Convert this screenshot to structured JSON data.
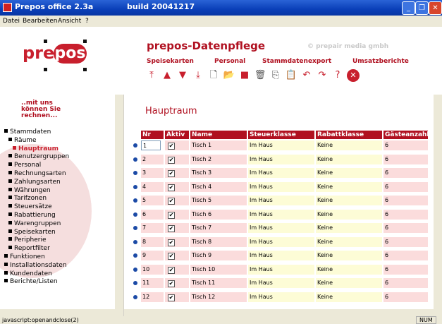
{
  "window": {
    "title": "Prepos office 2.3a",
    "build": "build 20041217",
    "minimize": "_",
    "maximize": "❐",
    "close": "✕"
  },
  "menu": [
    "Datei",
    "Bearbeiten",
    "Ansicht",
    "?"
  ],
  "header": {
    "logo_left": "pre",
    "logo_right": "pos",
    "title": "prepos-Datenpflege",
    "copyright": "© prepair media gmbh",
    "nav": [
      "Speisekarten",
      "Personal",
      "Stammdatenexport",
      "Umsatzberichte"
    ]
  },
  "toolbar_icons": [
    "first-icon",
    "up-icon",
    "down-icon",
    "last-icon",
    "new-document-icon",
    "open-folder-icon",
    "save-icon",
    "delete-icon",
    "copy-icon",
    "paste-icon",
    "undo-icon",
    "redo-icon",
    "help-icon",
    "close-icon"
  ],
  "sidebar": {
    "heading": [
      "..mit uns",
      "können Sie",
      "rechnen..."
    ],
    "items": [
      {
        "label": "Stammdaten",
        "level": 0
      },
      {
        "label": "Räume",
        "level": 1
      },
      {
        "label": "Hauptraum",
        "level": 2,
        "active": true
      },
      {
        "label": "Benutzergruppen",
        "level": 1
      },
      {
        "label": "Personal",
        "level": 1
      },
      {
        "label": "Rechnungsarten",
        "level": 1
      },
      {
        "label": "Zahlungsarten",
        "level": 1
      },
      {
        "label": "Währungen",
        "level": 1
      },
      {
        "label": "Tarifzonen",
        "level": 1
      },
      {
        "label": "Steuersätze",
        "level": 1
      },
      {
        "label": "Rabattierung",
        "level": 1
      },
      {
        "label": "Warengruppen",
        "level": 1
      },
      {
        "label": "Speisekarten",
        "level": 1
      },
      {
        "label": "Peripherie",
        "level": 1
      },
      {
        "label": "Reportfilter",
        "level": 1
      },
      {
        "label": "Funktionen",
        "level": 0
      },
      {
        "label": "Installationsdaten",
        "level": 0
      },
      {
        "label": "Kundendaten",
        "level": 0
      },
      {
        "label": "Berichte/Listen",
        "level": 0
      }
    ]
  },
  "main": {
    "title": "Hauptraum",
    "columns": [
      "Nr",
      "Aktiv",
      "Name",
      "Steuerklasse",
      "Rabattklasse",
      "Gästeanzahl"
    ],
    "rows": [
      {
        "nr": "1",
        "aktiv": "✔",
        "name": "Tisch 1",
        "steuer": "Im Haus",
        "rabatt": "Keine",
        "gaeste": "6"
      },
      {
        "nr": "2",
        "aktiv": "✔",
        "name": "Tisch 2",
        "steuer": "Im Haus",
        "rabatt": "Keine",
        "gaeste": "6"
      },
      {
        "nr": "3",
        "aktiv": "✔",
        "name": "Tisch 3",
        "steuer": "Im Haus",
        "rabatt": "Keine",
        "gaeste": "6"
      },
      {
        "nr": "4",
        "aktiv": "✔",
        "name": "Tisch 4",
        "steuer": "Im Haus",
        "rabatt": "Keine",
        "gaeste": "6"
      },
      {
        "nr": "5",
        "aktiv": "✔",
        "name": "Tisch 5",
        "steuer": "Im Haus",
        "rabatt": "Keine",
        "gaeste": "6"
      },
      {
        "nr": "6",
        "aktiv": "✔",
        "name": "Tisch 6",
        "steuer": "Im Haus",
        "rabatt": "Keine",
        "gaeste": "6"
      },
      {
        "nr": "7",
        "aktiv": "✔",
        "name": "Tisch 7",
        "steuer": "Im Haus",
        "rabatt": "Keine",
        "gaeste": "6"
      },
      {
        "nr": "8",
        "aktiv": "✔",
        "name": "Tisch 8",
        "steuer": "Im Haus",
        "rabatt": "Keine",
        "gaeste": "6"
      },
      {
        "nr": "9",
        "aktiv": "✔",
        "name": "Tisch 9",
        "steuer": "Im Haus",
        "rabatt": "Keine",
        "gaeste": "6"
      },
      {
        "nr": "10",
        "aktiv": "✔",
        "name": "Tisch 10",
        "steuer": "Im Haus",
        "rabatt": "Keine",
        "gaeste": "6"
      },
      {
        "nr": "11",
        "aktiv": "✔",
        "name": "Tisch 11",
        "steuer": "Im Haus",
        "rabatt": "Keine",
        "gaeste": "6"
      },
      {
        "nr": "12",
        "aktiv": "✔",
        "name": "Tisch 12",
        "steuer": "Im Haus",
        "rabatt": "Keine",
        "gaeste": "6"
      }
    ]
  },
  "status": {
    "text": "javascript:openandclose(2)",
    "num": "NUM"
  },
  "colors": {
    "accent": "#b01020",
    "row_pink": "#fbdcdc",
    "row_yellow": "#fdfcd6",
    "title_blue": "#0a3fb8"
  }
}
